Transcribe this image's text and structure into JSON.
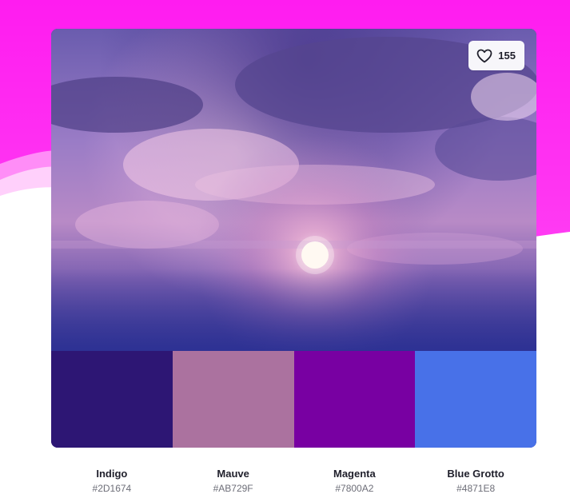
{
  "like": {
    "count": "155",
    "icon": "heart-icon"
  },
  "photo": {
    "subject": "purple sunset sky with clouds"
  },
  "palette": [
    {
      "name": "Indigo",
      "hex": "#2D1674",
      "color": "#2D1674"
    },
    {
      "name": "Mauve",
      "hex": "#AB729F",
      "color": "#AB729F"
    },
    {
      "name": "Magenta",
      "hex": "#7800A2",
      "color": "#7800A2"
    },
    {
      "name": "Blue Grotto",
      "hex": "#4871E8",
      "color": "#4871E8"
    }
  ],
  "colors": {
    "background_band": "#FF1DF2",
    "background": "#FFFFFF"
  }
}
